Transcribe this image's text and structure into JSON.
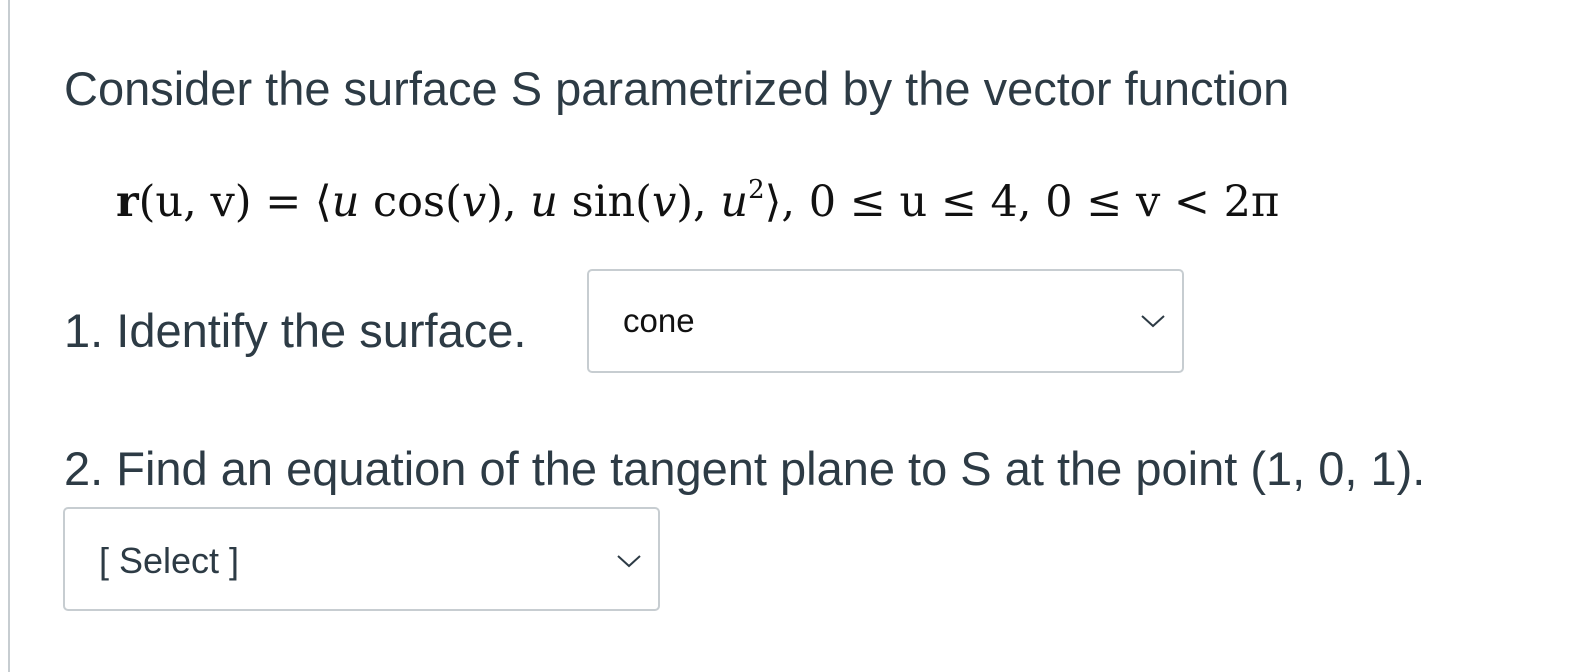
{
  "question": {
    "intro": "Consider the surface S parametrized by the vector function",
    "formula": {
      "lhs_fn": "r",
      "lhs_args": "(u, v)",
      "equals": " = ",
      "rhs_open": "⟨",
      "rhs_u1": "u",
      "rhs_cos": " cos(",
      "rhs_v1": "v",
      "rhs_close1": "), ",
      "rhs_u2": "u",
      "rhs_sin": " sin(",
      "rhs_v2": "v",
      "rhs_close2": "), ",
      "rhs_u3": "u",
      "rhs_exp": "2",
      "rhs_close": "⟩, ",
      "domain_u": "0 ≤ u ≤ 4, ",
      "domain_v": "0 ≤ v < 2π"
    }
  },
  "parts": [
    {
      "label": "1.  Identify the surface.",
      "selected": "cone",
      "icon": "chevron-down-icon"
    },
    {
      "label": "2.  Find an equation of the tangent plane to S at the point (1, 0, 1).",
      "selected": "[ Select ]",
      "icon": "chevron-down-icon"
    }
  ],
  "colors": {
    "text": "#2d3b45",
    "border": "#c7cdd1",
    "math": "#111111"
  }
}
